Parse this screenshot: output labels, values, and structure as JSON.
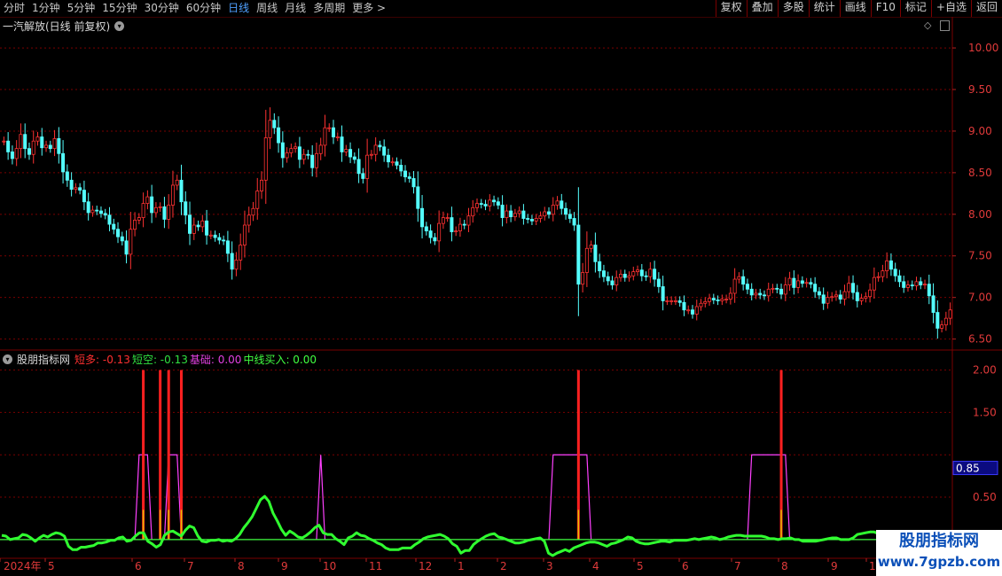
{
  "toolbar": {
    "timeframes": [
      "分时",
      "1分钟",
      "5分钟",
      "15分钟",
      "30分钟",
      "60分钟",
      "日线",
      "周线",
      "月线",
      "多周期",
      "更多 >"
    ],
    "active": "日线",
    "tools": [
      "复权",
      "叠加",
      "多股",
      "统计",
      "画线",
      "F10",
      "标记",
      "+自选",
      "返回"
    ]
  },
  "main_panel": {
    "title": "一汽解放(日线 前复权)",
    "price_axis": [
      "10.00",
      "9.50",
      "9.00",
      "8.50",
      "8.00",
      "7.50",
      "7.00",
      "6.50"
    ]
  },
  "indicator_panel": {
    "title": "股朋指标网",
    "legend": [
      {
        "label": "短多: -0.13",
        "color": "#ff3030"
      },
      {
        "label": "短空: -0.13",
        "color": "#30e040"
      },
      {
        "label": "基础: 0.00",
        "color": "#e040e0"
      },
      {
        "label": "中线买入: 0.00",
        "color": "#40ff40"
      }
    ],
    "axis": [
      "2.00",
      "1.50",
      "0.50"
    ],
    "current_value": "0.85"
  },
  "time_axis": [
    "2024年",
    "5",
    "6",
    "7",
    "8",
    "9",
    "10",
    "11",
    "12",
    "1",
    "2",
    "3",
    "4",
    "5",
    "6",
    "7",
    "8",
    "9",
    "10",
    "1"
  ],
  "watermark": {
    "line1": "股朋指标网",
    "line2": "www.7gpzb.com"
  },
  "colors": {
    "up": "#ff3232",
    "down": "#54ffff",
    "grid": "#7a0000",
    "signal_red": "#ff2020",
    "signal_magenta": "#ff40ff",
    "curve_green": "#30ff30"
  },
  "chart_data": {
    "type": "candlestick",
    "price_ylim": [
      6.4,
      10.15
    ],
    "indicator_ylim": [
      -0.2,
      2.1
    ],
    "close": [
      8.88,
      8.75,
      8.67,
      8.79,
      8.96,
      8.79,
      8.72,
      8.88,
      8.93,
      8.8,
      8.83,
      8.79,
      8.91,
      8.73,
      8.51,
      8.41,
      8.3,
      8.32,
      8.29,
      8.15,
      8.02,
      8.05,
      8.04,
      8.01,
      7.99,
      7.88,
      7.82,
      7.73,
      7.68,
      7.52,
      7.82,
      7.93,
      7.96,
      8.13,
      8.21,
      8.02,
      8.08,
      8.09,
      7.94,
      8.11,
      8.35,
      8.41,
      8.15,
      7.99,
      7.77,
      7.87,
      7.85,
      7.92,
      7.75,
      7.75,
      7.72,
      7.69,
      7.68,
      7.53,
      7.34,
      7.45,
      7.63,
      7.87,
      7.99,
      8.07,
      8.28,
      8.41,
      8.92,
      9.13,
      9.04,
      8.86,
      8.68,
      8.74,
      8.79,
      8.81,
      8.66,
      8.72,
      8.71,
      8.56,
      8.73,
      8.83,
      9.04,
      9.04,
      8.93,
      8.93,
      8.75,
      8.78,
      8.69,
      8.66,
      8.49,
      8.43,
      8.71,
      8.72,
      8.83,
      8.81,
      8.71,
      8.63,
      8.63,
      8.59,
      8.52,
      8.45,
      8.43,
      8.33,
      8.07,
      7.85,
      7.8,
      7.72,
      7.68,
      7.89,
      7.96,
      7.96,
      7.79,
      7.8,
      7.88,
      7.87,
      7.98,
      8.08,
      8.13,
      8.12,
      8.1,
      8.17,
      8.15,
      8.11,
      7.96,
      8.04,
      7.97,
      8.01,
      8.04,
      7.95,
      7.94,
      7.92,
      7.95,
      7.98,
      8.03,
      8.0,
      8.11,
      8.16,
      8.07,
      8.0,
      7.95,
      7.87,
      7.16,
      7.3,
      7.59,
      7.63,
      7.43,
      7.32,
      7.25,
      7.2,
      7.15,
      7.24,
      7.28,
      7.24,
      7.26,
      7.31,
      7.33,
      7.26,
      7.25,
      7.34,
      7.22,
      7.13,
      6.96,
      6.96,
      6.96,
      6.96,
      6.94,
      6.85,
      6.85,
      6.8,
      6.89,
      6.93,
      6.95,
      6.99,
      6.97,
      6.96,
      6.98,
      6.98,
      7.05,
      7.22,
      7.25,
      7.16,
      7.1,
      7.03,
      7.05,
      7.03,
      7.02,
      7.1,
      7.11,
      7.1,
      7.04,
      7.15,
      7.23,
      7.12,
      7.2,
      7.17,
      7.18,
      7.16,
      7.07,
      7.03,
      6.93,
      7.0,
      7.01,
      7.03,
      6.98,
      7.07,
      7.17,
      7.06,
      6.96,
      6.99,
      7.01,
      7.09,
      7.24,
      7.25,
      7.32,
      7.44,
      7.34,
      7.26,
      7.19,
      7.12,
      7.15,
      7.14,
      7.19,
      7.15,
      7.16,
      7.02,
      6.82,
      6.63,
      6.67,
      6.75,
      6.85
    ],
    "indicator_curve": [
      0.05,
      0.04,
      0.0,
      0.01,
      0.02,
      0.06,
      0.05,
      0.02,
      -0.02,
      0.02,
      0.05,
      0.03,
      0.06,
      0.08,
      0.07,
      0.04,
      -0.08,
      -0.12,
      -0.12,
      -0.09,
      -0.09,
      -0.08,
      -0.07,
      -0.04,
      -0.04,
      -0.03,
      -0.01,
      -0.01,
      0.02,
      0.03,
      -0.02,
      -0.01,
      0.04,
      0.08,
      0.08,
      -0.02,
      -0.05,
      -0.09,
      -0.06,
      0.05,
      0.09,
      0.1,
      0.07,
      0.04,
      0.11,
      0.16,
      0.14,
      0.04,
      -0.02,
      -0.03,
      -0.01,
      -0.01,
      0.0,
      -0.02,
      -0.01,
      -0.02,
      0.01,
      0.06,
      0.14,
      0.2,
      0.27,
      0.37,
      0.47,
      0.51,
      0.45,
      0.31,
      0.22,
      0.12,
      0.05,
      0.1,
      0.07,
      0.03,
      0.02,
      0.05,
      0.09,
      0.14,
      0.17,
      0.08,
      0.06,
      0.06,
      0.01,
      -0.02,
      -0.06,
      0.02,
      0.04,
      0.08,
      0.05,
      0.04,
      0.01,
      -0.01,
      -0.04,
      -0.06,
      -0.1,
      -0.12,
      -0.12,
      -0.12,
      -0.1,
      -0.1,
      -0.1,
      -0.06,
      -0.03,
      0.01,
      0.03,
      0.04,
      0.05,
      0.06,
      0.04,
      0.01,
      -0.05,
      -0.08,
      -0.16,
      -0.13,
      -0.13,
      -0.06,
      -0.02,
      0.01,
      0.04,
      0.06,
      0.07,
      0.03,
      0.02,
      0.0,
      -0.02,
      -0.04,
      -0.04,
      -0.03,
      -0.01,
      0.0,
      0.01,
      0.02,
      -0.02,
      -0.16,
      -0.19,
      -0.16,
      -0.14,
      -0.12,
      -0.14,
      -0.1,
      -0.08,
      -0.06,
      -0.04,
      -0.03,
      -0.03,
      -0.04,
      -0.06,
      -0.08,
      -0.05,
      -0.04,
      -0.02,
      0.0,
      0.03,
      0.02,
      -0.02,
      -0.04,
      -0.05,
      -0.05,
      -0.04,
      -0.03,
      -0.02,
      -0.02,
      -0.03,
      -0.01,
      -0.01,
      -0.01,
      -0.01,
      0.0,
      0.01,
      0.0,
      0.01,
      0.02,
      0.03,
      0.02,
      0.0,
      0.01,
      0.03,
      0.04,
      0.05,
      0.05,
      0.04,
      0.04,
      0.04,
      0.04,
      0.04,
      0.03,
      0.01,
      0.01,
      0.0,
      0.01,
      0.01,
      0.02,
      0.0,
      0.0,
      -0.02,
      -0.02,
      -0.02,
      -0.02,
      -0.01,
      0.0,
      0.01,
      0.02,
      0.02,
      0.0,
      0.0,
      0.0,
      0.02,
      0.06,
      0.07,
      0.08,
      0.09,
      0.09,
      0.07,
      0.04,
      0.02,
      0.01,
      -0.02,
      -0.03
    ]
  }
}
